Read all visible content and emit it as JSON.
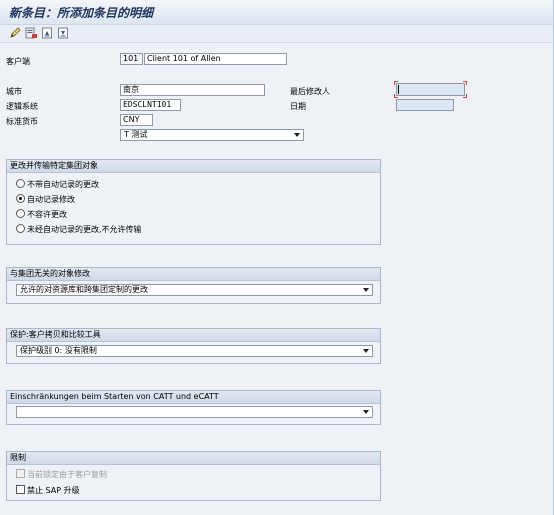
{
  "window": {
    "title": "新条目：所添加条目的明细"
  },
  "toolbar": {
    "icons": [
      "edit-icon",
      "exit-icon",
      "first-entry-icon",
      "last-entry-icon"
    ]
  },
  "client": {
    "label": "客户端",
    "number": "101",
    "name": "Client 101 of Allen"
  },
  "city": {
    "label": "城市",
    "value": "南京"
  },
  "logical_system": {
    "label": "逻辑系统",
    "value": "EDSCLNT101"
  },
  "currency": {
    "label": "标准货币",
    "value": "CNY"
  },
  "role": {
    "value": "T 测试"
  },
  "changed_by": {
    "label": "最后修改人",
    "value": ""
  },
  "date": {
    "label": "日期",
    "value": ""
  },
  "group_changes": {
    "title": "更改并传输特定集团对象",
    "options": [
      {
        "label": "不带自动记录的更改",
        "selected": false
      },
      {
        "label": "自动记录修改",
        "selected": true
      },
      {
        "label": "不容许更改",
        "selected": false
      },
      {
        "label": "未经自动记录的更改,不允许传输",
        "selected": false
      }
    ]
  },
  "cross_client": {
    "title": "与集团无关的对象修改",
    "selected": "允许的对资源库和跨集团定制的更改"
  },
  "protection": {
    "title": "保护:客户拷贝和比较工具",
    "selected": "保护级别 0: 没有限制"
  },
  "catt": {
    "title": "Einschränkungen beim Starten von CATT und eCATT",
    "selected": ""
  },
  "restrictions": {
    "title": "限制",
    "locked_label": "当前锁定由于客户复制",
    "no_upgrade_label": "禁止 SAP 升级"
  }
}
